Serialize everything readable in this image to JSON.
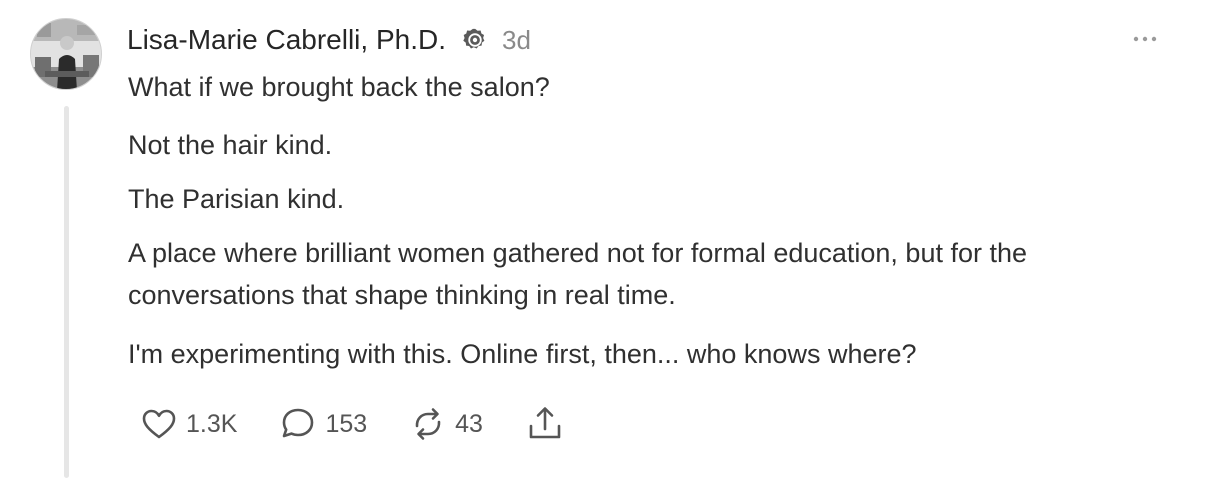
{
  "post": {
    "author": "Lisa-Marie Cabrelli, Ph.D.",
    "time": "3d",
    "paragraphs": [
      "What if we brought back the salon?",
      "Not the hair kind.",
      "The Parisian kind.",
      "A place where brilliant women gathered not for formal education, but for the conversations that shape thinking in real time.",
      "I'm experimenting with this. Online first, then... who knows where?"
    ]
  },
  "actions": {
    "likes": "1.3K",
    "comments": "153",
    "reposts": "43"
  },
  "icons": {
    "verified": "verified-badge-icon",
    "more": "more-options-icon",
    "like": "heart-icon",
    "comment": "comment-bubble-icon",
    "repost": "repost-arrows-icon",
    "share": "share-upload-icon"
  },
  "colors": {
    "text": "#262626",
    "muted": "#8a8a8a",
    "thread_line": "#e6e6e6",
    "icon": "#555555"
  }
}
